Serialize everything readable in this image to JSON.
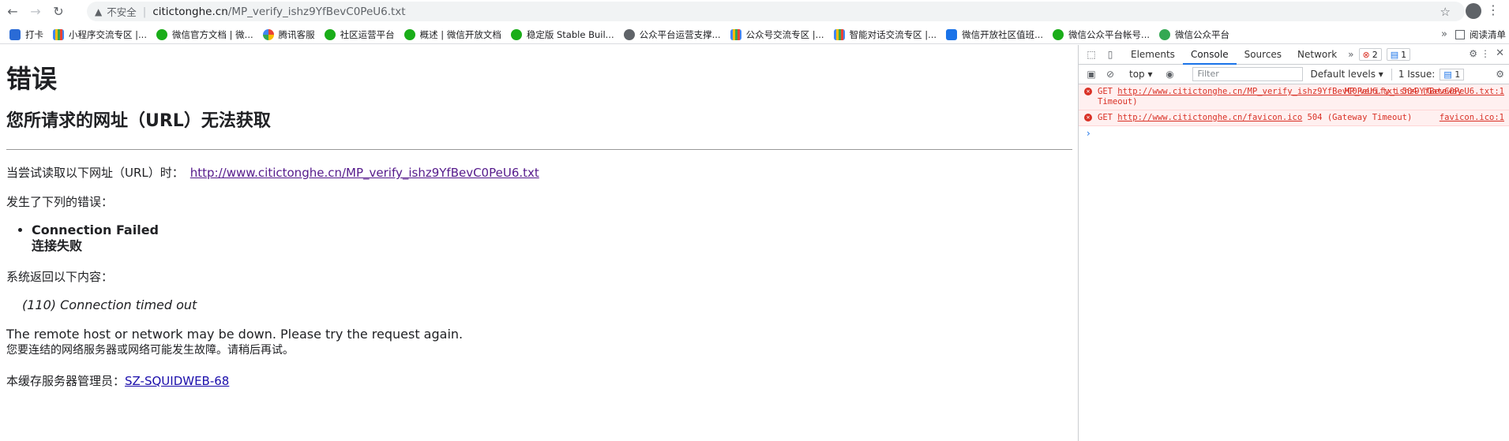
{
  "browser": {
    "insecure_label": "不安全",
    "url_host": "citictonghe.cn",
    "url_path": "/MP_verify_ishz9YfBevC0PeU6.txt"
  },
  "bookmarks": [
    {
      "label": "打卡",
      "icon": "blue"
    },
    {
      "label": "小程序交流专区 |...",
      "icon": "grid"
    },
    {
      "label": "微信官方文档 | 微...",
      "icon": "wx"
    },
    {
      "label": "腾讯客服",
      "icon": "multi"
    },
    {
      "label": "社区运营平台",
      "icon": "wx"
    },
    {
      "label": "概述 | 微信开放文档",
      "icon": "wx"
    },
    {
      "label": "稳定版 Stable Buil...",
      "icon": "wx"
    },
    {
      "label": "公众平台运营支撑...",
      "icon": "grey"
    },
    {
      "label": "公众号交流专区 |...",
      "icon": "grid"
    },
    {
      "label": "智能对话交流专区 |...",
      "icon": "grid"
    },
    {
      "label": "微信开放社区值班...",
      "icon": "doc"
    },
    {
      "label": "微信公众平台帐号...",
      "icon": "wx"
    },
    {
      "label": "微信公众平台",
      "icon": "green"
    }
  ],
  "bookmarks_more": "»",
  "reader_mode": "阅读清单",
  "page": {
    "title": "错误",
    "subtitle": "您所请求的网址（URL）无法获取",
    "trying_label": "当尝试读取以下网址（URL）时：",
    "trying_url": "http://www.citictonghe.cn/MP_verify_ishz9YfBevC0PeU6.txt",
    "error_intro": "发生了下列的错误：",
    "error_en": "Connection Failed",
    "error_cn": "连接失败",
    "returned_intro": "系统返回以下内容：",
    "returned_msg": "(110) Connection timed out",
    "remote_en": "The remote host or network may be down. Please try the request again.",
    "remote_cn": "您要连结的网络服务器或网络可能发生故障。请稍后再试。",
    "admin_label": "本缓存服务器管理员：",
    "admin_link": "SZ-SQUIDWEB-68"
  },
  "devtools": {
    "tabs": [
      "Elements",
      "Console",
      "Sources",
      "Network"
    ],
    "active_tab": "Console",
    "more": "»",
    "error_count": "2",
    "info_count": "1",
    "context": "top",
    "filter_placeholder": "Filter",
    "levels": "Default levels",
    "issues_label": "1 Issue:",
    "issues_count": "1",
    "logs": [
      {
        "method": "GET",
        "url": "http://www.citictonghe.cn/MP_verify_ishz9YfBevC0PeU6.txt",
        "status": "504 (Gateway Timeout)",
        "source": "MP_verify_ishz9YfBevC0PeU6.txt:1"
      },
      {
        "method": "GET",
        "url": "http://www.citictonghe.cn/favicon.ico",
        "status": "504 (Gateway Timeout)",
        "source": "favicon.ico:1"
      }
    ],
    "prompt": "›"
  }
}
